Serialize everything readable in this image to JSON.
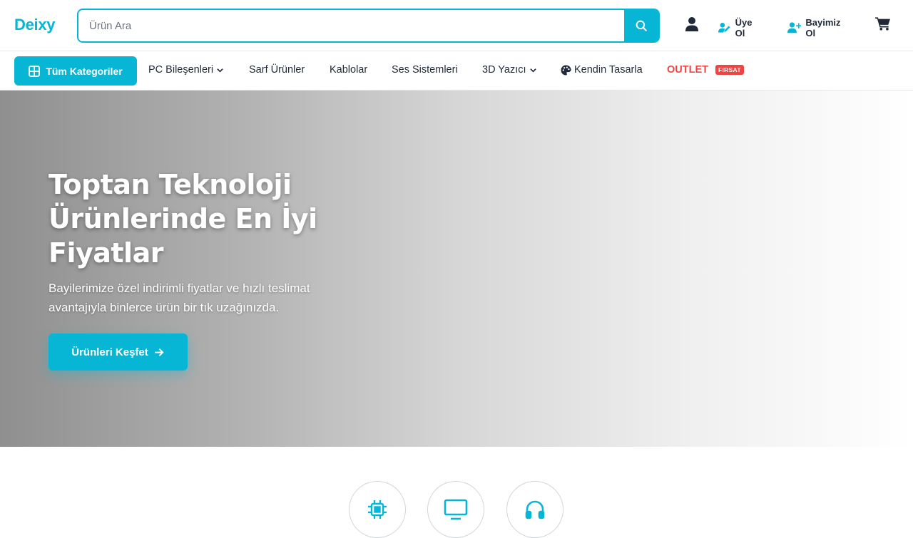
{
  "header": {
    "logo": "Deixy",
    "search": {
      "placeholder": "Ürün Ara",
      "value": ""
    },
    "actions": {
      "signup_label": "Üye Ol",
      "dealer_label": "Bayimiz Ol"
    }
  },
  "nav": {
    "all_categories_label": "Tüm Kategoriler",
    "items": [
      {
        "label": "PC Bileşenleri",
        "has_dropdown": true
      },
      {
        "label": "Sarf Ürünler",
        "has_dropdown": false
      },
      {
        "label": "Kablolar",
        "has_dropdown": false
      },
      {
        "label": "Ses Sistemleri",
        "has_dropdown": false
      },
      {
        "label": "3D Yazıcı",
        "has_dropdown": true
      },
      {
        "label": "Kendin Tasarla",
        "has_dropdown": false,
        "icon": "palette-icon"
      },
      {
        "label": "OUTLET",
        "badge": "FIRSAT"
      }
    ]
  },
  "hero": {
    "title": "Toptan Teknoloji Ürünlerinde En İyi Fiyatlar",
    "subtitle": "Bayilerimize özel indirimli fiyatlar ve hızlı teslimat avantajıyla binlerce ürün bir tık uzağınızda.",
    "cta_label": "Ürünleri Keşfet"
  },
  "categories": [
    {
      "icon": "cpu-icon"
    },
    {
      "icon": "monitor-icon"
    },
    {
      "icon": "headphones-icon"
    }
  ],
  "colors": {
    "accent": "#06b6d4",
    "danger": "#ef4444",
    "text": "#1f2937"
  }
}
